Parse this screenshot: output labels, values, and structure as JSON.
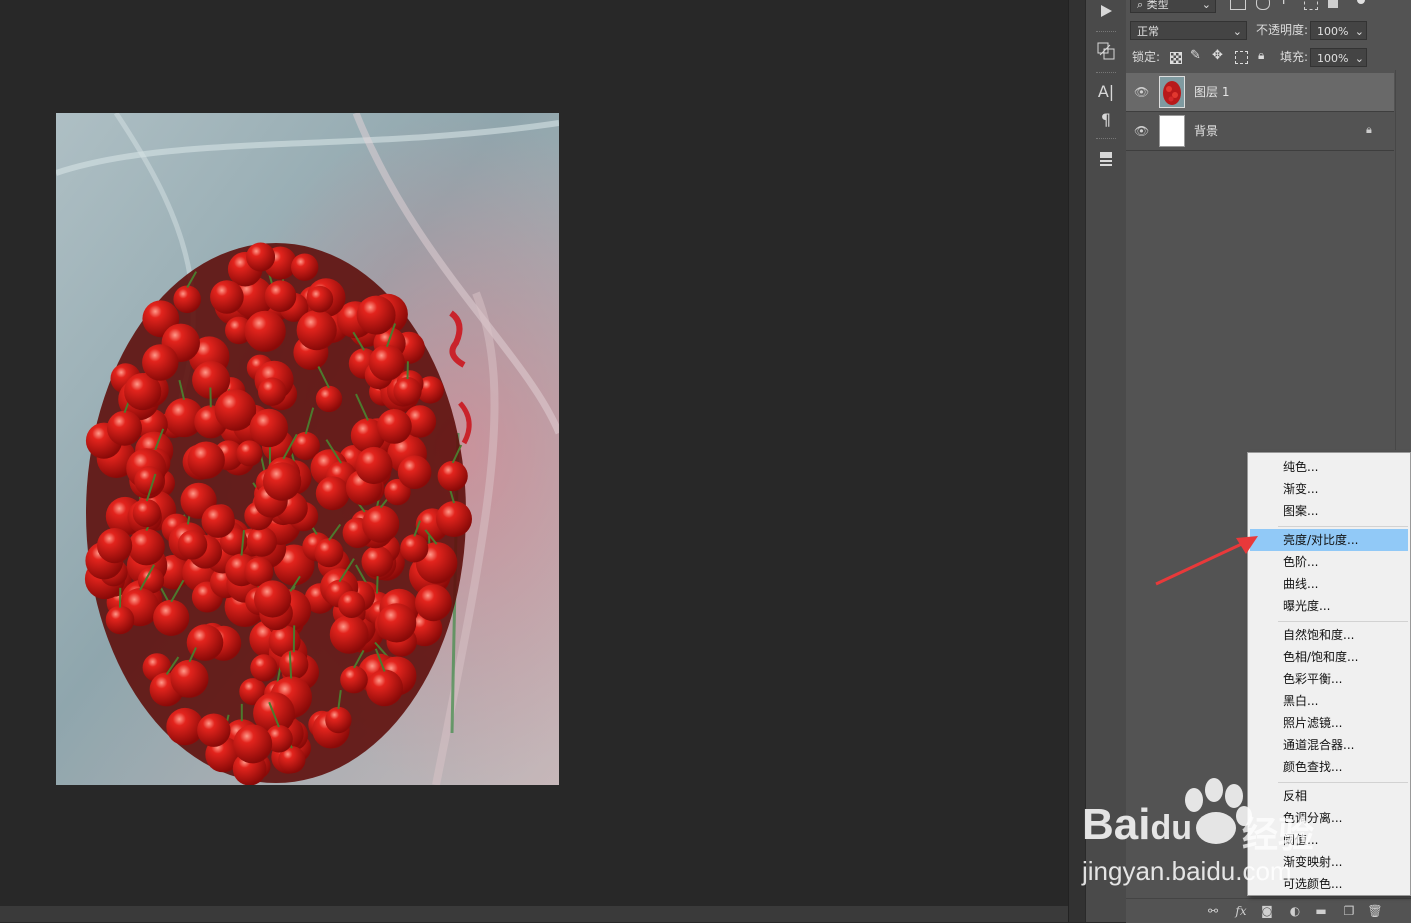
{
  "layers_panel": {
    "filter_kind": "类型",
    "blend_mode": "正常",
    "opacity_label": "不透明度:",
    "opacity_value": "100%",
    "lock_label": "锁定:",
    "fill_label": "填充:",
    "fill_value": "100%",
    "layers": [
      {
        "name": "图层 1",
        "visible": true,
        "selected": true
      },
      {
        "name": "背景",
        "visible": true,
        "locked": true
      }
    ]
  },
  "adjustment_menu": {
    "groups": [
      [
        "纯色...",
        "渐变...",
        "图案..."
      ],
      [
        "亮度/对比度...",
        "色阶...",
        "曲线...",
        "曝光度..."
      ],
      [
        "自然饱和度...",
        "色相/饱和度...",
        "色彩平衡...",
        "黑白...",
        "照片滤镜...",
        "通道混合器...",
        "颜色查找..."
      ],
      [
        "反相",
        "色调分离...",
        "阈值...",
        "渐变映射...",
        "可选颜色..."
      ]
    ],
    "highlighted": "亮度/对比度..."
  },
  "annotation": {
    "arrow_color": "#e8393a"
  },
  "watermark": {
    "brand": "Bai",
    "brand_suffix": "du",
    "chinese": "经验",
    "url": "jingyan.baidu.com"
  },
  "colors": {
    "highlight": "#91c9f7",
    "canvas_bg": "#282828",
    "panel_bg": "#535353"
  }
}
